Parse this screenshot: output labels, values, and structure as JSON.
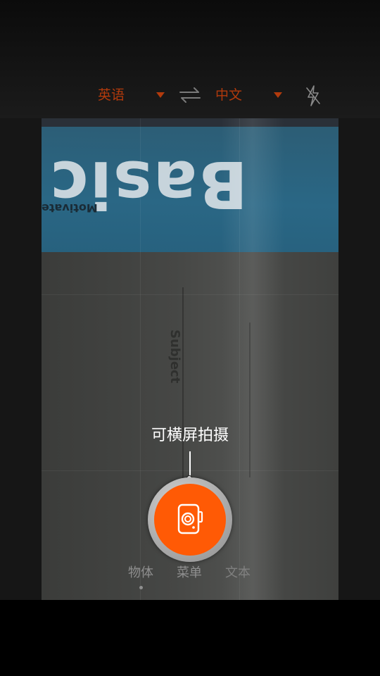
{
  "language_bar": {
    "source_language": "英语",
    "target_language": "中文",
    "swap_icon": "swap-arrows-icon",
    "flash_icon": "flash-auto-icon"
  },
  "preview": {
    "visible_text": {
      "title_word": "Basic",
      "subtitle_word": "Motivate",
      "side_word": "Subject"
    }
  },
  "hint": {
    "text": "可横屏拍摄"
  },
  "shutter": {
    "icon": "camera-icon"
  },
  "modes": {
    "items": [
      {
        "label": "物体",
        "selected": true
      },
      {
        "label": "菜单",
        "selected": false
      },
      {
        "label": "文本",
        "selected": false
      }
    ]
  },
  "colors": {
    "accent": "#ff5a05",
    "language_text": "#b23a0c",
    "mode_text": "#8f8f8f"
  }
}
